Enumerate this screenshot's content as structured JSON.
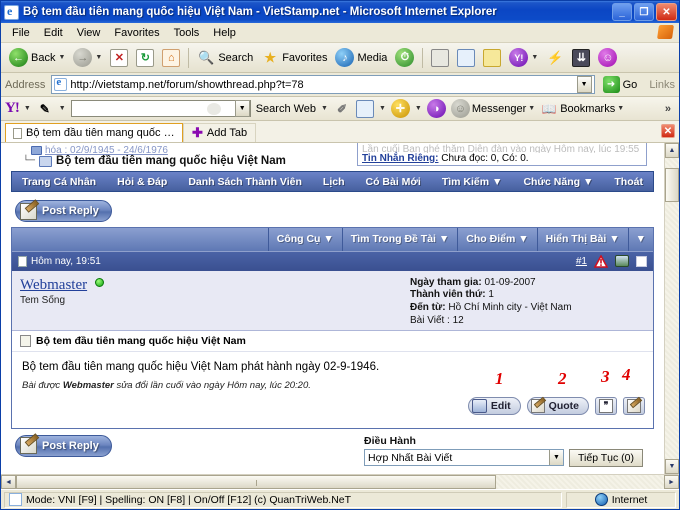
{
  "window": {
    "title": "Bộ tem đầu tiên mang quốc hiệu Việt Nam - VietStamp.net - Microsoft Internet Explorer",
    "minimize_label": "_",
    "restore_label": "❐",
    "close_label": "✕"
  },
  "menu": {
    "items": [
      "File",
      "Edit",
      "View",
      "Favorites",
      "Tools",
      "Help"
    ]
  },
  "toolbar": {
    "back_label": "Back",
    "forward_label": "",
    "stop_label": "✕",
    "refresh_label": "↻",
    "home_label": "⌂",
    "search_label": "Search",
    "favorites_label": "Favorites",
    "media_label": "Media",
    "history_label": "",
    "print_label": "",
    "edit_label": "",
    "note_label": "",
    "yahoo_label": "Y!",
    "messenger_label": "",
    "download_label": "",
    "emoticon_label": ""
  },
  "address": {
    "label": "Address",
    "url": "http://vietstamp.net/forum/showthread.php?t=78",
    "go_label": "Go",
    "links_label": "Links"
  },
  "yahoo_bar": {
    "logo": "Y!",
    "search_value": "",
    "search_web_label": "Search Web",
    "messenger_label": "Messenger",
    "bookmarks_label": "Bookmarks",
    "overflow_label": "»"
  },
  "tabs": {
    "items": [
      {
        "label": "Bộ tem đầu tiên mang quốc hiệu..."
      }
    ],
    "add_tab_label": "Add Tab",
    "close_label": "✕"
  },
  "page": {
    "breadcrumb_top": "hóa : 02/9/1945 - 24/6/1976",
    "breadcrumb_main": "Bộ tem đầu tiên mang quốc hiệu Việt Nam",
    "notice_line1": "Lần cuối Bạn ghé thăm Diễn đàn vào ngày Hôm nay, lúc 19:55",
    "notice_pm_link": "Tin Nhắn Riêng:",
    "notice_pm_text": "Chưa đọc: 0, Có: 0.",
    "nav_items": [
      "Trang Cá Nhân",
      "Hỏi & Đáp",
      "Danh Sách Thành Viên",
      "Lịch",
      "Có Bài Mới",
      "Tìm Kiếm ▼",
      "Chức Năng ▼",
      "Thoát"
    ],
    "post_reply_top_label": "Post Reply",
    "post_reply_bottom_label": "Post Reply",
    "thread_tools": [
      {
        "label": "Công Cụ ▼"
      },
      {
        "label": "Tìm Trong Đề Tài ▼"
      },
      {
        "label": "Cho Điểm ▼"
      },
      {
        "label": "Hiển Thị Bài ▼"
      },
      {
        "label": "▼"
      }
    ],
    "post": {
      "timestamp": "Hôm nay, 19:51",
      "post_number": "#1",
      "username": "Webmaster",
      "user_title": "Tem Sống",
      "stats": [
        {
          "label": "Ngày tham gia:",
          "value": "01-09-2007"
        },
        {
          "label": "Thành viên thứ:",
          "value": "1"
        },
        {
          "label": "Đến từ:",
          "value": "Hồ Chí Minh city - Việt Nam"
        },
        {
          "label": "Bài Viết :",
          "value": "12"
        }
      ],
      "subject": "Bộ tem đầu tiên mang quốc hiệu Việt Nam",
      "message": "Bộ tem đầu tiên mang quốc hiệu Việt Nam phát hành ngày 02-9-1946.",
      "edit_prefix": "Bài được",
      "edit_author": "Webmaster",
      "edit_suffix": "sửa đổi lần cuối vào ngày Hôm nay, lúc",
      "edit_time": "20:20.",
      "buttons": [
        {
          "label": "Edit",
          "icon": "scissors-icon",
          "annotation": "1"
        },
        {
          "label": "Quote",
          "icon": "quote-pen-icon",
          "annotation": "2"
        },
        {
          "label": "",
          "icon": "multiquote-icon",
          "annotation": "3"
        },
        {
          "label": "",
          "icon": "quick-reply-icon",
          "annotation": "4"
        }
      ]
    },
    "moderation": {
      "title": "Điều Hành",
      "selected_option": "Hợp Nhất Bài Viết",
      "options": [
        "Hợp Nhất Bài Viết"
      ],
      "continue_label": "Tiếp Tục (0)"
    }
  },
  "statusbar": {
    "message": "Mode: VNI [F9] | Spelling: ON [F8] | On/Off [F12] (c) QuanTriWeb.NeT",
    "zone": "Internet"
  },
  "colors": {
    "titlebar_blue": "#0b46c4",
    "nav_blue": "#46609e",
    "post_header_blue": "#3a5090",
    "annotation_red": "#e00000",
    "link_blue": "#22409a"
  }
}
